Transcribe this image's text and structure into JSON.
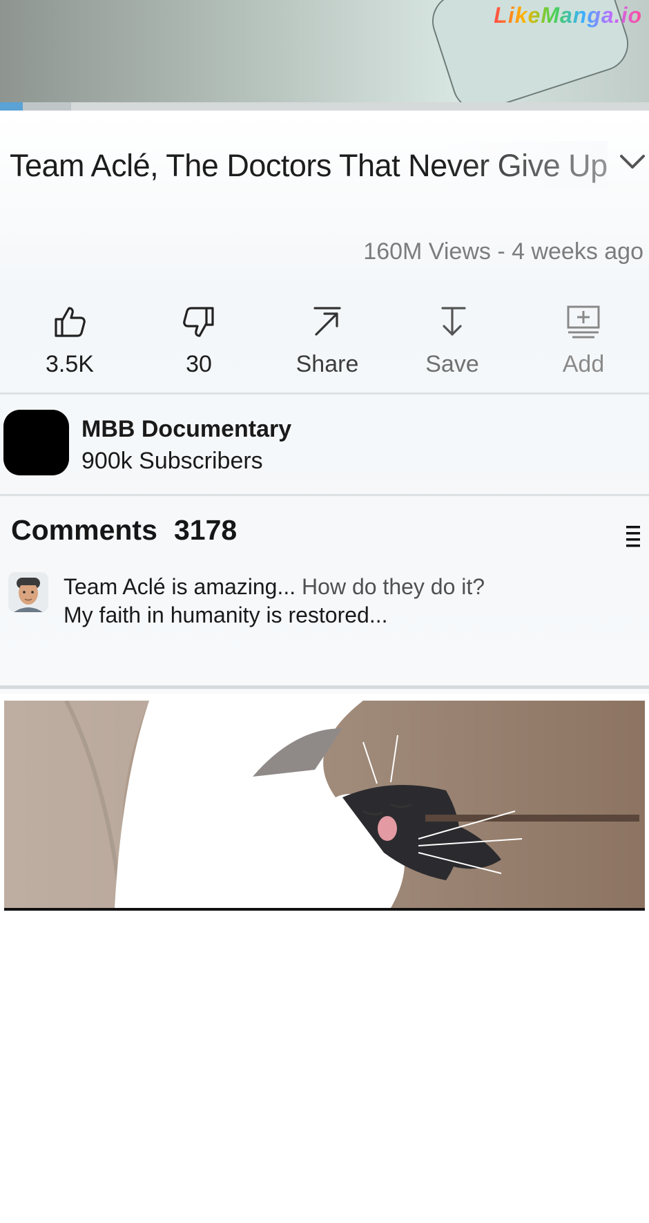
{
  "video": {
    "progress_fraction": 0.035,
    "buffer_fraction": 0.11,
    "watermark_text": "LikeManga.io",
    "title": "Team Aclé, The Doctors That Never Give Up",
    "views_text": "160M Views - 4 weeks ago"
  },
  "actions": [
    {
      "icon": "thumbs-up-icon",
      "label": "3.5K"
    },
    {
      "icon": "thumbs-down-icon",
      "label": "30"
    },
    {
      "icon": "share-arrow-icon",
      "label": "Share"
    },
    {
      "icon": "save-download-icon",
      "label": "Save"
    },
    {
      "icon": "add-to-playlist-icon",
      "label": "Add"
    }
  ],
  "channel": {
    "name": "MBB Documentary",
    "subscribers": "900k Subscribers"
  },
  "comments": {
    "heading": "Comments",
    "count": "3178",
    "sort_icon": "sort-menu-icon",
    "top_comment": {
      "prefix_line1": "Team Aclé is amazing...",
      "suffix_line1": " How do they do it?",
      "line2": "My faith in humanity is restored..."
    }
  },
  "colors": {
    "progress": "#5ba2d6",
    "text_primary": "#1d1d1d",
    "text_secondary": "#7c7c7c"
  }
}
